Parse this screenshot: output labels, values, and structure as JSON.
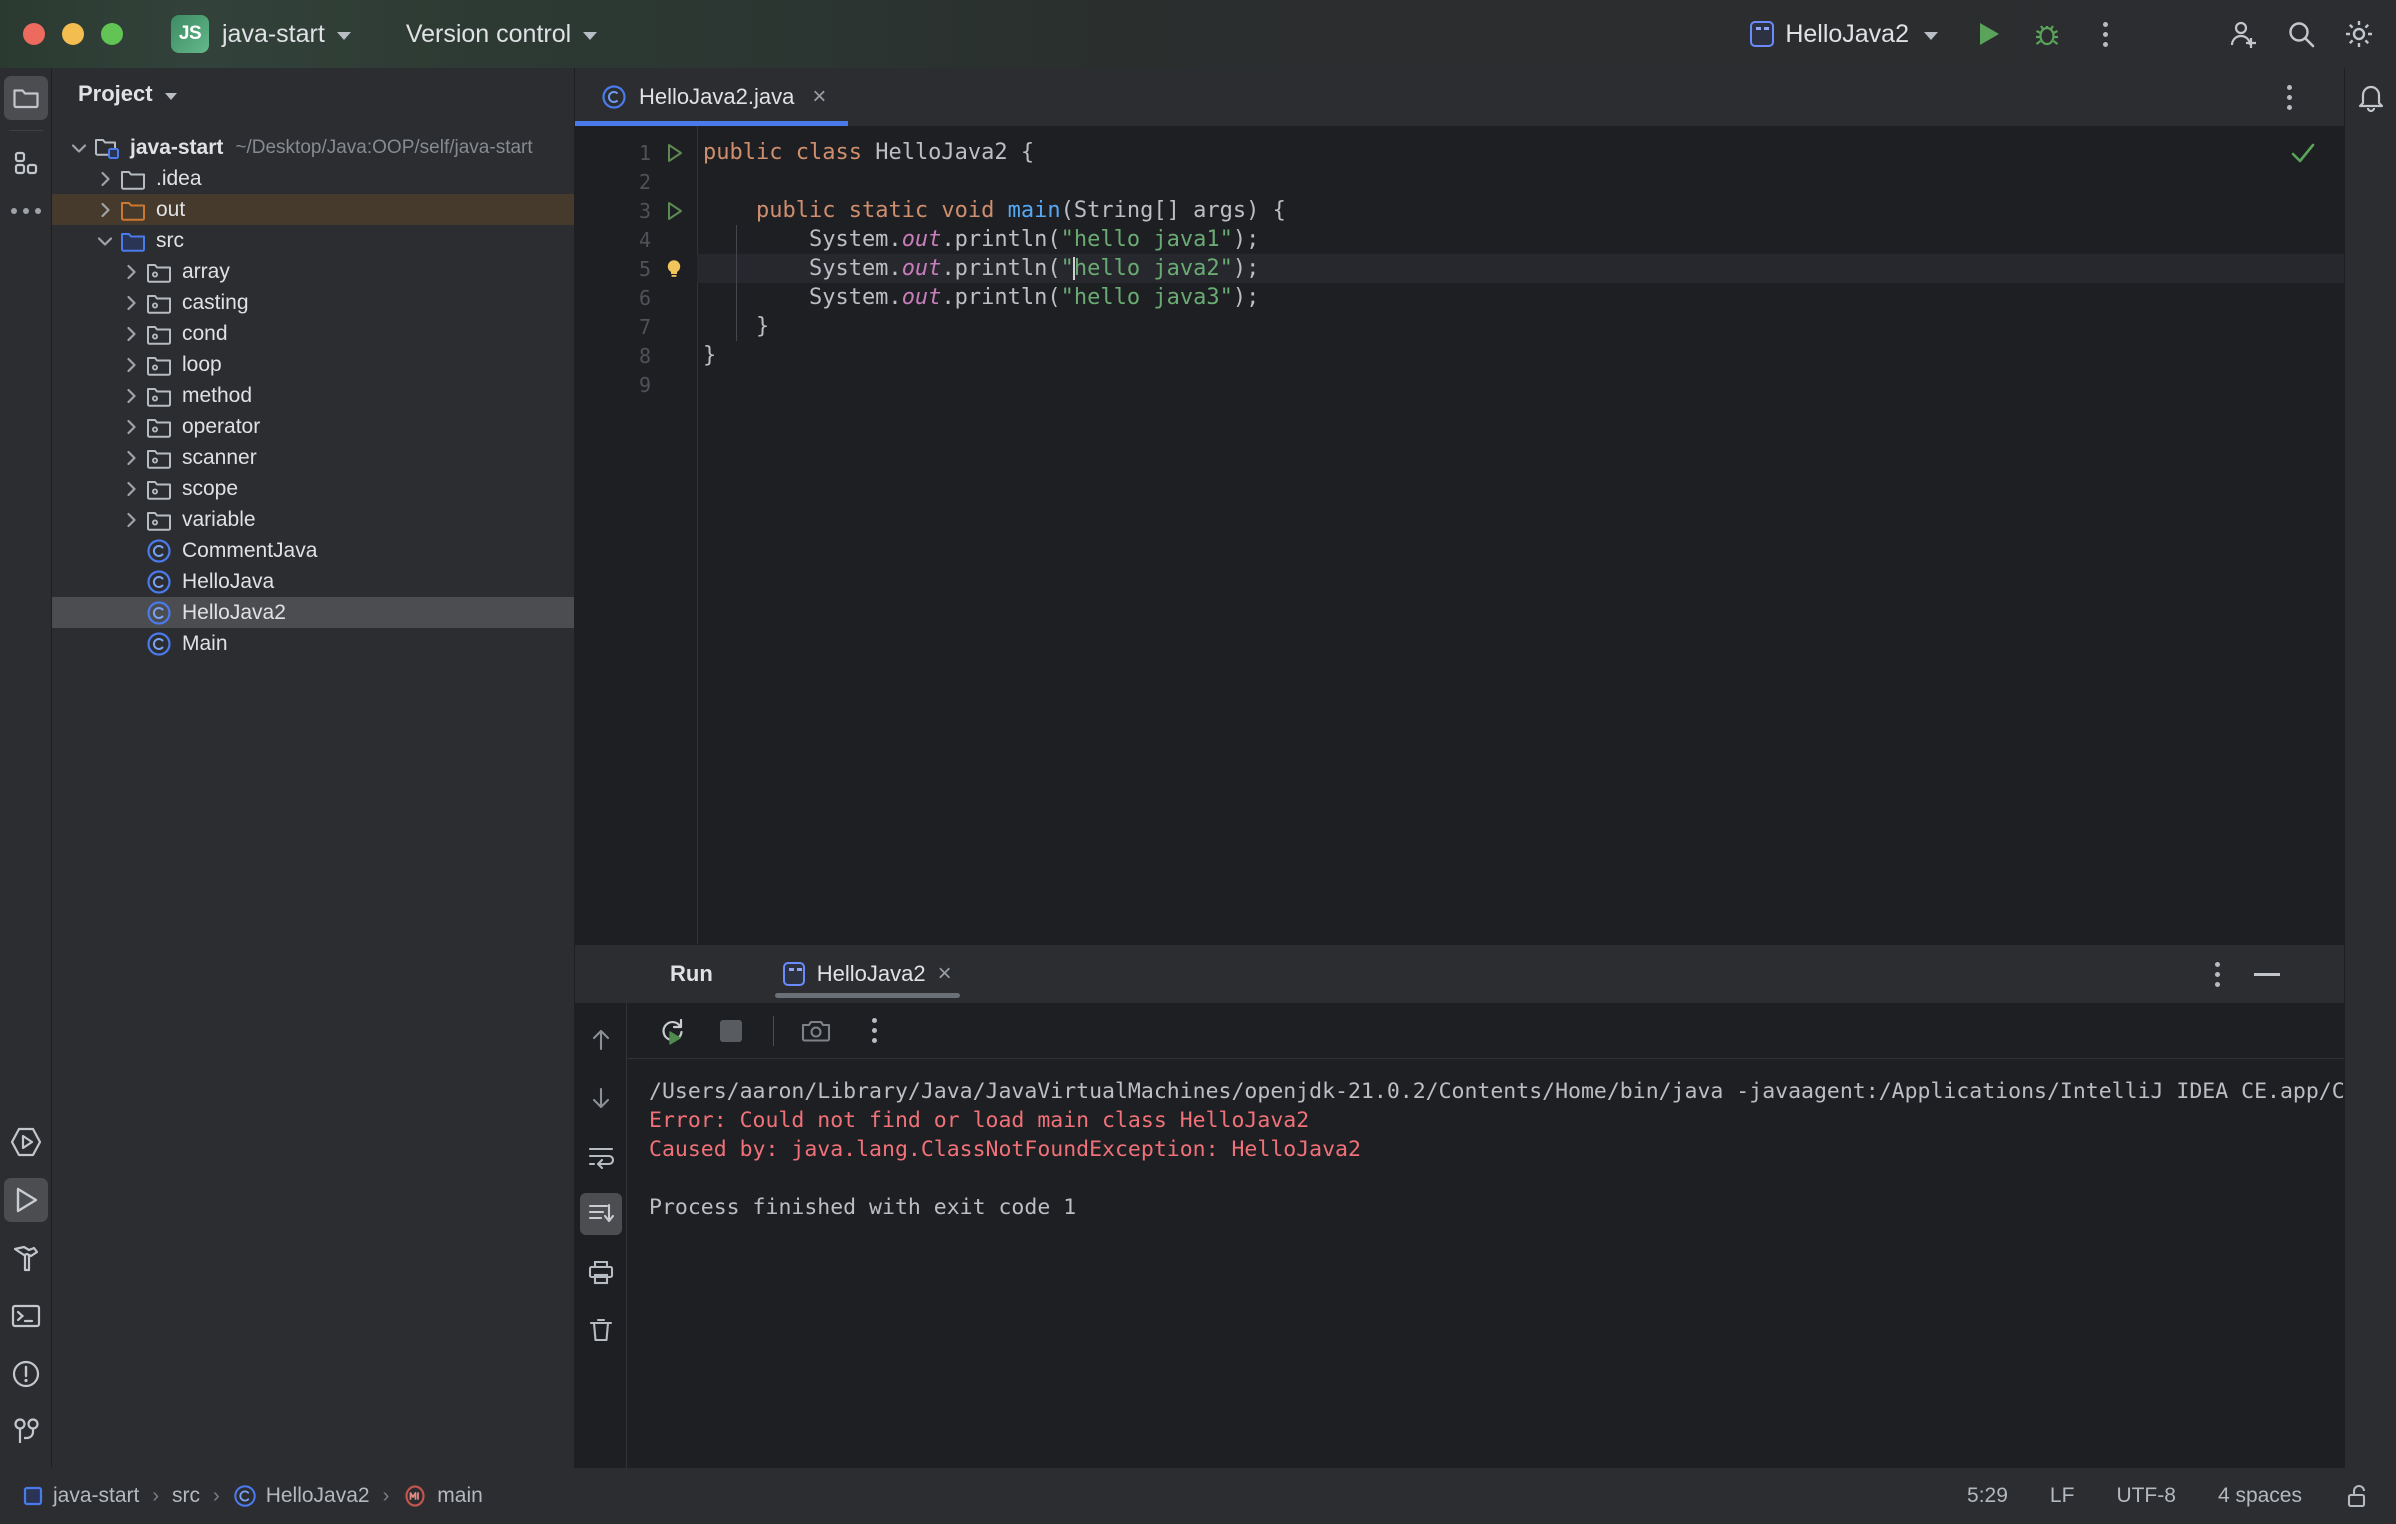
{
  "titlebar": {
    "project_badge": "JS",
    "project_name": "java-start",
    "vcs_label": "Version control",
    "run_config": "HelloJava2",
    "icons": [
      "run-icon",
      "debug-icon",
      "more-options-icon",
      "add-account-icon",
      "search-icon",
      "settings-icon"
    ]
  },
  "project_panel": {
    "title": "Project",
    "tree": [
      {
        "label": "java-start",
        "path": "~/Desktop/Java:OOP/self/java-start",
        "icon": "project-folder-icon",
        "indent": 0,
        "expanded": true,
        "bold": true,
        "state": "normal"
      },
      {
        "label": ".idea",
        "path": "",
        "icon": "folder-icon",
        "indent": 1,
        "expanded": false,
        "bold": false,
        "state": "normal"
      },
      {
        "label": "out",
        "path": "",
        "icon": "excluded-folder-icon",
        "indent": 1,
        "expanded": false,
        "bold": false,
        "state": "excluded"
      },
      {
        "label": "src",
        "path": "",
        "icon": "source-folder-icon",
        "indent": 1,
        "expanded": true,
        "bold": false,
        "state": "normal"
      },
      {
        "label": "array",
        "path": "",
        "icon": "package-icon",
        "indent": 2,
        "expanded": false,
        "bold": false,
        "state": "normal"
      },
      {
        "label": "casting",
        "path": "",
        "icon": "package-icon",
        "indent": 2,
        "expanded": false,
        "bold": false,
        "state": "normal"
      },
      {
        "label": "cond",
        "path": "",
        "icon": "package-icon",
        "indent": 2,
        "expanded": false,
        "bold": false,
        "state": "normal"
      },
      {
        "label": "loop",
        "path": "",
        "icon": "package-icon",
        "indent": 2,
        "expanded": false,
        "bold": false,
        "state": "normal"
      },
      {
        "label": "method",
        "path": "",
        "icon": "package-icon",
        "indent": 2,
        "expanded": false,
        "bold": false,
        "state": "normal"
      },
      {
        "label": "operator",
        "path": "",
        "icon": "package-icon",
        "indent": 2,
        "expanded": false,
        "bold": false,
        "state": "normal"
      },
      {
        "label": "scanner",
        "path": "",
        "icon": "package-icon",
        "indent": 2,
        "expanded": false,
        "bold": false,
        "state": "normal"
      },
      {
        "label": "scope",
        "path": "",
        "icon": "package-icon",
        "indent": 2,
        "expanded": false,
        "bold": false,
        "state": "normal"
      },
      {
        "label": "variable",
        "path": "",
        "icon": "package-icon",
        "indent": 2,
        "expanded": false,
        "bold": false,
        "state": "normal"
      },
      {
        "label": "CommentJava",
        "path": "",
        "icon": "java-class-icon",
        "indent": 2,
        "expanded": null,
        "bold": false,
        "state": "normal"
      },
      {
        "label": "HelloJava",
        "path": "",
        "icon": "java-class-icon",
        "indent": 2,
        "expanded": null,
        "bold": false,
        "state": "normal"
      },
      {
        "label": "HelloJava2",
        "path": "",
        "icon": "java-class-icon",
        "indent": 2,
        "expanded": null,
        "bold": false,
        "state": "selected"
      },
      {
        "label": "Main",
        "path": "",
        "icon": "java-class-icon",
        "indent": 2,
        "expanded": null,
        "bold": false,
        "state": "normal"
      }
    ]
  },
  "editor": {
    "tab_label": "HelloJava2.java",
    "tab_close": "×",
    "lines": [
      {
        "num": "1",
        "gutter": "run-marker",
        "tokens": [
          {
            "t": "public ",
            "c": "kw"
          },
          {
            "t": "class ",
            "c": "kw"
          },
          {
            "t": "HelloJava2 {",
            "c": ""
          }
        ],
        "indent_guides": 0,
        "highlight": false
      },
      {
        "num": "2",
        "gutter": "",
        "tokens": [],
        "indent_guides": 0,
        "highlight": false
      },
      {
        "num": "3",
        "gutter": "run-marker",
        "tokens": [
          {
            "t": "    ",
            "c": ""
          },
          {
            "t": "public ",
            "c": "kw"
          },
          {
            "t": "static ",
            "c": "kw"
          },
          {
            "t": "void ",
            "c": "kw"
          },
          {
            "t": "main",
            "c": "fn"
          },
          {
            "t": "(String[] args) {",
            "c": ""
          }
        ],
        "indent_guides": 0,
        "highlight": false
      },
      {
        "num": "4",
        "gutter": "",
        "tokens": [
          {
            "t": "        System.",
            "c": ""
          },
          {
            "t": "out",
            "c": "fld"
          },
          {
            "t": ".println(",
            "c": ""
          },
          {
            "t": "\"hello java1\"",
            "c": "str"
          },
          {
            "t": ");",
            "c": ""
          }
        ],
        "indent_guides": 1,
        "highlight": false
      },
      {
        "num": "5",
        "gutter": "intention-bulb",
        "tokens": [
          {
            "t": "        System.",
            "c": ""
          },
          {
            "t": "out",
            "c": "fld"
          },
          {
            "t": ".println(",
            "c": ""
          },
          {
            "t": "\"",
            "c": "str"
          },
          {
            "t": "CARET",
            "c": "caret"
          },
          {
            "t": "hello java2\"",
            "c": "str"
          },
          {
            "t": ");",
            "c": ""
          }
        ],
        "indent_guides": 1,
        "highlight": true
      },
      {
        "num": "6",
        "gutter": "",
        "tokens": [
          {
            "t": "        System.",
            "c": ""
          },
          {
            "t": "out",
            "c": "fld"
          },
          {
            "t": ".println(",
            "c": ""
          },
          {
            "t": "\"hello java3\"",
            "c": "str"
          },
          {
            "t": ");",
            "c": ""
          }
        ],
        "indent_guides": 1,
        "highlight": false
      },
      {
        "num": "7",
        "gutter": "",
        "tokens": [
          {
            "t": "    }",
            "c": ""
          }
        ],
        "indent_guides": 0,
        "highlight": false
      },
      {
        "num": "8",
        "gutter": "",
        "tokens": [
          {
            "t": "}",
            "c": ""
          }
        ],
        "indent_guides": 0,
        "highlight": false
      },
      {
        "num": "9",
        "gutter": "",
        "tokens": [],
        "indent_guides": 0,
        "highlight": false
      }
    ],
    "inspection_status": "ok-checkmark"
  },
  "run_panel": {
    "title": "Run",
    "tab_label": "HelloJava2",
    "tab_close": "×",
    "toolbar_icons": [
      "rerun-icon",
      "stop-icon",
      "screenshot-icon",
      "more-options-icon"
    ],
    "side_icons": [
      "scroll-up-icon",
      "scroll-down-icon",
      "soft-wrap-icon",
      "scroll-to-end-icon",
      "print-icon",
      "clear-all-icon"
    ],
    "console": [
      {
        "text": "/Users/aaron/Library/Java/JavaVirtualMachines/openjdk-21.0.2/Contents/Home/bin/java -javaagent:/Applications/IntelliJ IDEA CE.app/Contents/l",
        "type": "normal"
      },
      {
        "text": "Error: Could not find or load main class HelloJava2",
        "type": "error"
      },
      {
        "text": "Caused by: java.lang.ClassNotFoundException: HelloJava2",
        "type": "error"
      },
      {
        "text": "",
        "type": "normal"
      },
      {
        "text": "Process finished with exit code 1",
        "type": "normal"
      }
    ]
  },
  "status_bar": {
    "breadcrumbs": [
      {
        "label": "java-start",
        "icon": "module-icon"
      },
      {
        "label": "src",
        "icon": ""
      },
      {
        "label": "HelloJava2",
        "icon": "java-class-icon"
      },
      {
        "label": "main",
        "icon": "method-icon"
      }
    ],
    "separator": "›",
    "caret_position": "5:29",
    "line_separator": "LF",
    "encoding": "UTF-8",
    "indent": "4 spaces",
    "lock_icon": "unlocked-icon"
  },
  "colors": {
    "accent": "#4a7aeb",
    "keyword": "#cf8e6d",
    "string": "#6aab73",
    "method": "#56a8f5",
    "field": "#c77dbb",
    "error": "#f07178",
    "bg_editor": "#1e1f22",
    "bg_panel": "#2b2d30",
    "selection": "#4b4d51",
    "excluded": "#453a2b"
  }
}
